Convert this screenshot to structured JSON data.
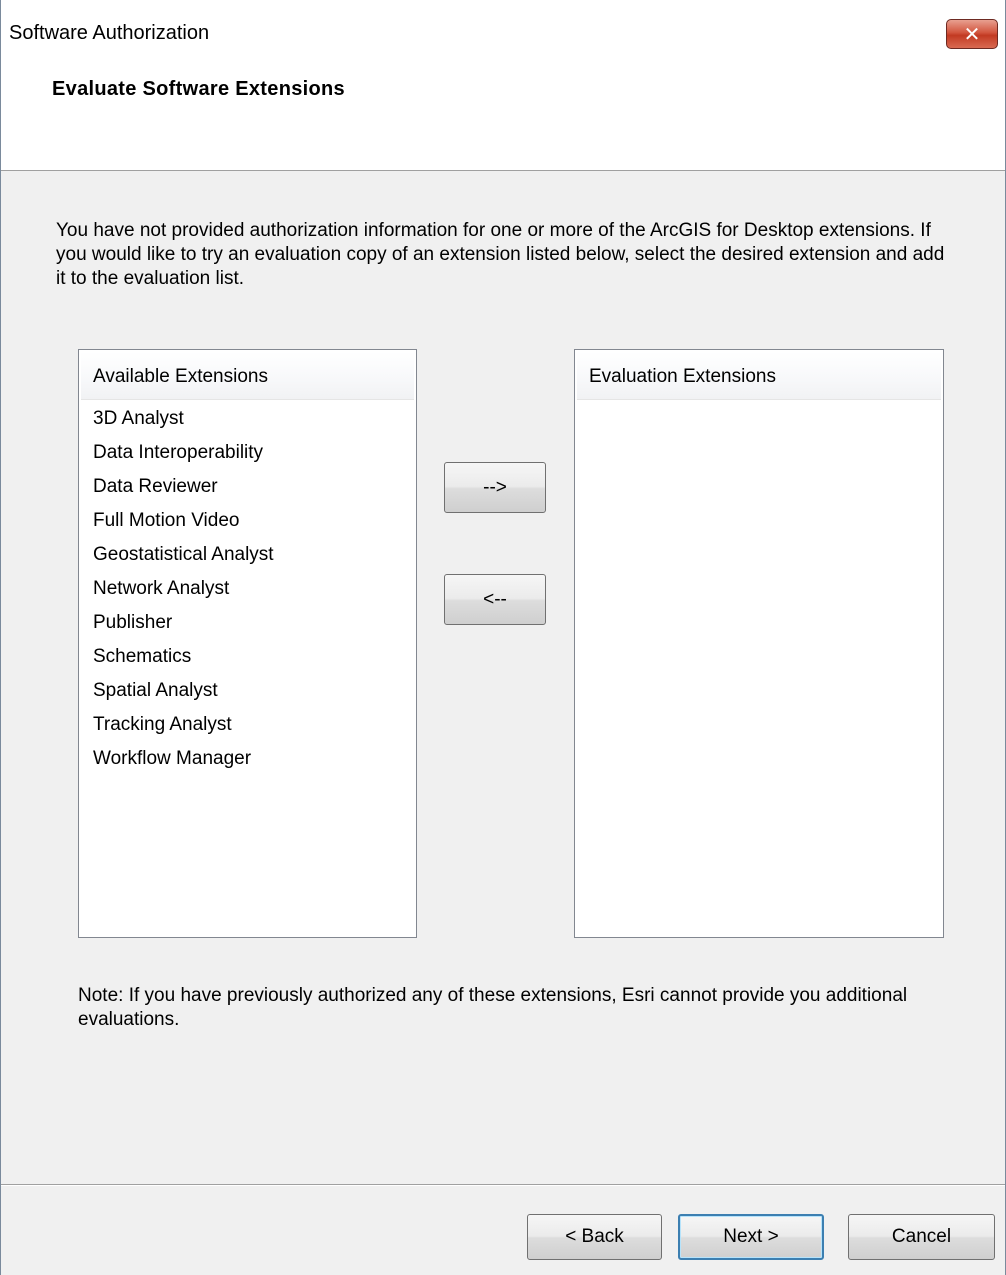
{
  "window": {
    "title": "Software Authorization",
    "close_glyph": "✕"
  },
  "header": {
    "title": "Evaluate Software Extensions"
  },
  "intro_text": "You have not provided authorization information for one or more of the ArcGIS for Desktop extensions.  If you would like to try an evaluation copy of an extension listed below, select the desired extension and add it to the evaluation list.",
  "available": {
    "header": "Available Extensions",
    "items": [
      "3D Analyst",
      "Data Interoperability",
      "Data Reviewer",
      "Full Motion Video",
      "Geostatistical Analyst",
      "Network Analyst",
      "Publisher",
      "Schematics",
      "Spatial Analyst",
      "Tracking Analyst",
      "Workflow Manager"
    ]
  },
  "evaluation": {
    "header": "Evaluation Extensions",
    "items": []
  },
  "transfer": {
    "add_label": "-->",
    "remove_label": "<--"
  },
  "note_text": "Note:  If you have previously authorized any of these extensions, Esri cannot provide you additional evaluations.",
  "footer": {
    "back_label": "< Back",
    "next_label": "Next >",
    "cancel_label": "Cancel"
  },
  "colors": {
    "window_bg": "#f0f0f0",
    "close_button": "#c23a22",
    "default_button_border": "#3c7fb1"
  },
  "icons": {
    "close": "close-icon"
  }
}
